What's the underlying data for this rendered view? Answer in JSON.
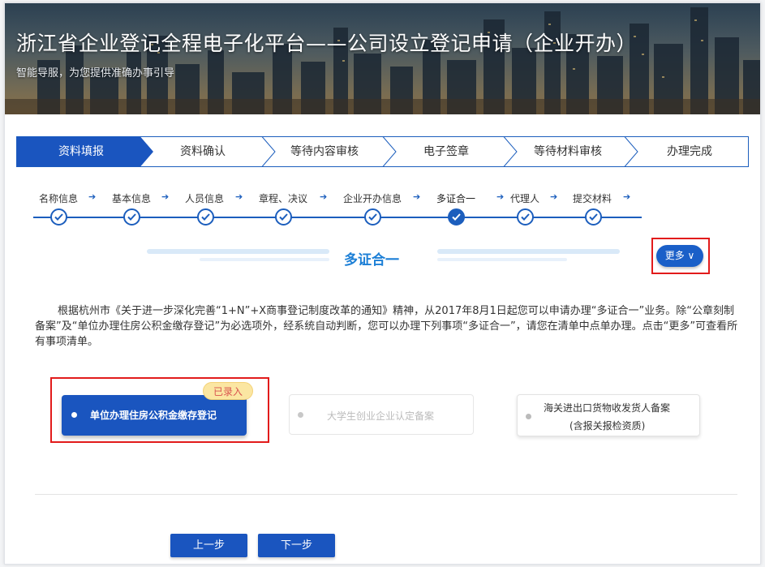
{
  "header": {
    "title": "浙江省企业登记全程电子化平台——公司设立登记申请（企业开办）",
    "subtitle": "智能导服，为您提供准确办事引导"
  },
  "steps": [
    {
      "label": "资料填报",
      "active": true
    },
    {
      "label": "资料确认",
      "active": false
    },
    {
      "label": "等待内容审核",
      "active": false
    },
    {
      "label": "电子签章",
      "active": false
    },
    {
      "label": "等待材料审核",
      "active": false
    },
    {
      "label": "办理完成",
      "active": false
    }
  ],
  "substeps": [
    {
      "label": "名称信息"
    },
    {
      "label": "基本信息"
    },
    {
      "label": "人员信息"
    },
    {
      "label": "章程、决议"
    },
    {
      "label": "企业开办信息"
    },
    {
      "label": "多证合一",
      "current": true
    },
    {
      "label": "代理人"
    },
    {
      "label": "提交材料"
    }
  ],
  "section": {
    "title": "多证合一",
    "more_label": "更多 ∨"
  },
  "description": "根据杭州市《关于进一步深化完善“1+N”+X商事登记制度改革的通知》精神，从2017年8月1日起您可以申请办理“多证合一”业务。除“公章刻制备案”及“单位办理住房公积金缴存登记”为必选项外，经系统自动判断，您可以办理下列事项“多证合一”，请您在清单中点单办理。点击“更多”可查看所有事项清单。",
  "options": {
    "selected": {
      "label": "单位办理住房公积金缴存登记",
      "badge": "已录入"
    },
    "disabled": {
      "label": "大学生创业企业认定备案"
    },
    "normal": {
      "line1": "海关进出口货物收发货人备案",
      "line2": "(含报关报检资质)"
    }
  },
  "buttons": {
    "prev": "上一步",
    "next": "下一步"
  },
  "colors": {
    "primary": "#1a55bf",
    "accent": "#1c7fd6",
    "highlight": "#e21b1b",
    "badge_bg": "#fbe6a2"
  }
}
